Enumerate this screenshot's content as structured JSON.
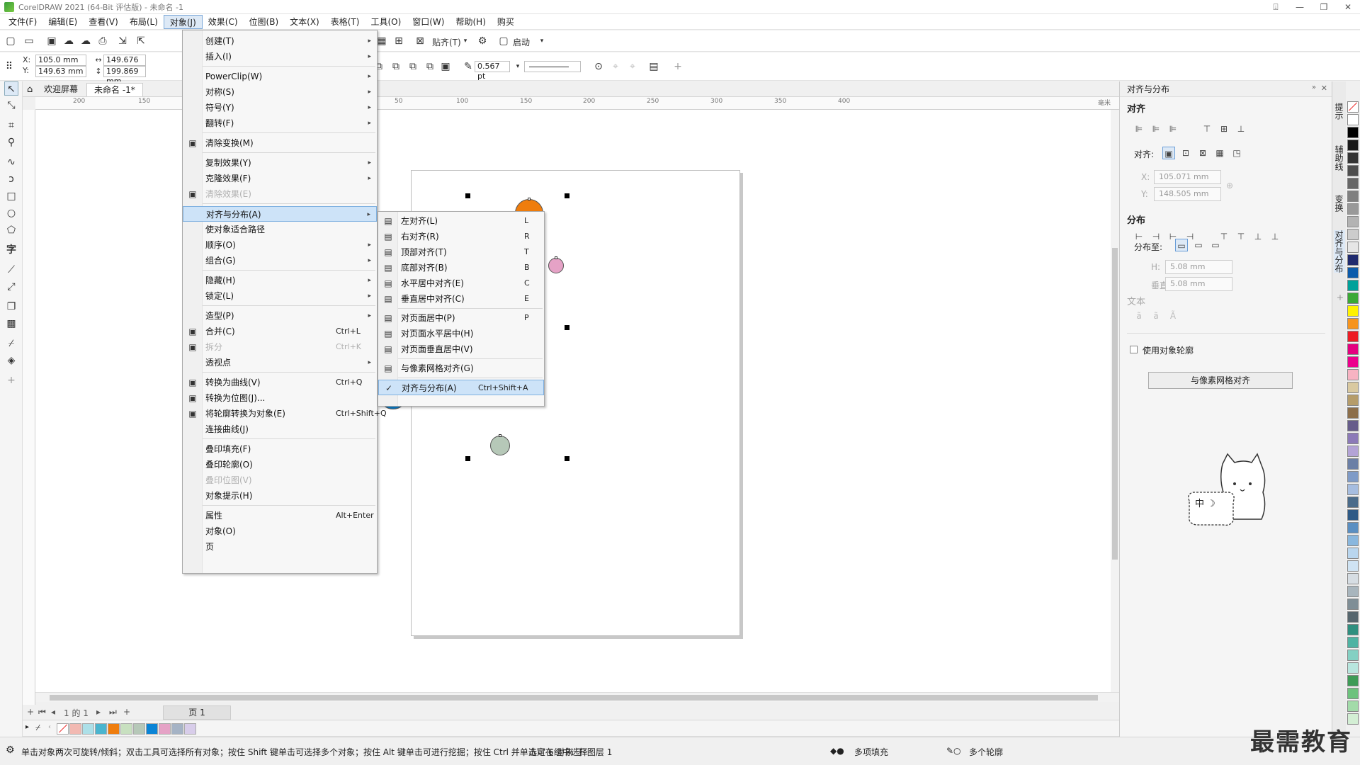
{
  "window": {
    "title": "CorelDRAW 2021 (64-Bit 评估版) - 未命名 -1",
    "controls": [
      "⍗",
      "—",
      "❐",
      "✕"
    ]
  },
  "menubar": [
    "文件(F)",
    "编辑(E)",
    "查看(V)",
    "布局(L)",
    "对象(J)",
    "效果(C)",
    "位图(B)",
    "文本(X)",
    "表格(T)",
    "工具(O)",
    "窗口(W)",
    "帮助(H)",
    "购买"
  ],
  "toolbar1": {
    "snap_label": "贴齐(T)",
    "launch_label": "启动"
  },
  "toolbar2": {
    "x": "105.0 mm",
    "y": "149.63 mm",
    "x_label": "X:",
    "y_label": "Y:",
    "w": "149.676 mm",
    "h": "199.869 mm",
    "outline": "0.567 pt"
  },
  "doctabs": [
    "欢迎屏幕",
    "未命名 -1*"
  ],
  "ruler_h": [
    "200",
    "150",
    "0",
    "50",
    "100",
    "150",
    "200",
    "250",
    "300",
    "350",
    "400"
  ],
  "ruler_unit": "毫米",
  "object_menu": [
    {
      "label": "创建(T)",
      "submenu": true
    },
    {
      "label": "插入(I)",
      "submenu": true
    },
    {
      "sep": true
    },
    {
      "label": "PowerClip(W)",
      "submenu": true
    },
    {
      "label": "对称(S)",
      "submenu": true
    },
    {
      "label": "符号(Y)",
      "submenu": true
    },
    {
      "label": "翻转(F)",
      "submenu": true
    },
    {
      "sep": true
    },
    {
      "label": "清除变换(M)",
      "icon": true
    },
    {
      "sep": true
    },
    {
      "label": "复制效果(Y)",
      "submenu": true
    },
    {
      "label": "克隆效果(F)",
      "submenu": true
    },
    {
      "label": "清除效果(E)",
      "disabled": true,
      "icon": true
    },
    {
      "sep": true
    },
    {
      "label": "对齐与分布(A)",
      "submenu": true,
      "highlighted": true
    },
    {
      "label": "使对象适合路径"
    },
    {
      "label": "顺序(O)",
      "submenu": true
    },
    {
      "label": "组合(G)",
      "submenu": true
    },
    {
      "sep": true
    },
    {
      "label": "隐藏(H)",
      "submenu": true
    },
    {
      "label": "锁定(L)",
      "submenu": true
    },
    {
      "sep": true
    },
    {
      "label": "造型(P)",
      "submenu": true
    },
    {
      "label": "合并(C)",
      "shortcut": "Ctrl+L",
      "icon": true
    },
    {
      "label": "拆分",
      "shortcut": "Ctrl+K",
      "disabled": true,
      "icon": true
    },
    {
      "label": "透视点",
      "submenu": true
    },
    {
      "sep": true
    },
    {
      "label": "转换为曲线(V)",
      "shortcut": "Ctrl+Q",
      "icon": true
    },
    {
      "label": "转换为位图(J)...",
      "icon": true
    },
    {
      "label": "将轮廓转换为对象(E)",
      "shortcut": "Ctrl+Shift+Q",
      "icon": true
    },
    {
      "label": "连接曲线(J)"
    },
    {
      "sep": true
    },
    {
      "label": "叠印填充(F)"
    },
    {
      "label": "叠印轮廓(O)"
    },
    {
      "label": "叠印位图(V)",
      "disabled": true
    },
    {
      "label": "对象提示(H)"
    },
    {
      "sep": true
    },
    {
      "label": "属性",
      "shortcut": "Alt+Enter"
    },
    {
      "label": "对象(O)"
    },
    {
      "label": "页"
    }
  ],
  "align_submenu": [
    {
      "label": "左对齐(L)",
      "shortcut": "L"
    },
    {
      "label": "右对齐(R)",
      "shortcut": "R"
    },
    {
      "label": "顶部对齐(T)",
      "shortcut": "T"
    },
    {
      "label": "底部对齐(B)",
      "shortcut": "B"
    },
    {
      "label": "水平居中对齐(E)",
      "shortcut": "C"
    },
    {
      "label": "垂直居中对齐(C)",
      "shortcut": "E"
    },
    {
      "sep": true
    },
    {
      "label": "对页面居中(P)",
      "shortcut": "P"
    },
    {
      "label": "对页面水平居中(H)",
      "shortcut": ""
    },
    {
      "label": "对页面垂直居中(V)",
      "shortcut": ""
    },
    {
      "sep": true
    },
    {
      "label": "与像素网格对齐(G)",
      "shortcut": ""
    },
    {
      "sep": true
    },
    {
      "label": "对齐与分布(A)",
      "shortcut": "Ctrl+Shift+A",
      "checked": true,
      "highlighted": true
    }
  ],
  "canvas": {
    "circles": [
      {
        "color": "#ef7d0d",
        "name": "orange-circle"
      },
      {
        "color": "#e5a2c6",
        "name": "pink-circle"
      },
      {
        "color": "#c8e0c0",
        "name": "light-green-circle"
      },
      {
        "color": "#0a84d6",
        "name": "blue-circle"
      },
      {
        "color": "#b6c8b8",
        "name": "gray-green-circle"
      }
    ]
  },
  "pagenav": {
    "pages": "1 的 1",
    "tab": "页 1"
  },
  "doc_palette": [
    "#f2b9b2",
    "#ade0e8",
    "#4ab5cf",
    "#ef7d0d",
    "#c8e0c0",
    "#b6c8b8",
    "#0a84d6",
    "#e5a2c6",
    "#a5b3c5",
    "#d8cdea"
  ],
  "status": {
    "hint": "单击对象两次可旋转/倾斜；双击工具可选择所有对象；按住 Shift 键单击可选择多个对象；按住 Alt 键单击可进行挖掘；按住 Ctrl 并单击可在组中选择",
    "selection": "选定 6 对象 于 图层 1",
    "fill": "多项填充",
    "outline": "多个轮廓"
  },
  "docker": {
    "title": "对齐与分布",
    "align_section": "对齐",
    "align_to_label": "对齐:",
    "x_label": "X:",
    "y_label": "Y:",
    "x_value": "105.071 mm",
    "y_value": "148.505 mm",
    "distribute_section": "分布",
    "distribute_to_label": "分布至:",
    "h_label": "H:",
    "v_label": "垂直:",
    "h_value": "5.08 mm",
    "v_value": "5.08 mm",
    "text_section": "文本",
    "use_outline_label": "使用对象轮廓",
    "pixel_grid_button": "与像素网格对齐",
    "mascot_text": "中 ☽"
  },
  "sidetabs": [
    "提示",
    "辅助线",
    "变换",
    "对齐与分布"
  ],
  "color_palette": [
    "#ffffff",
    "#000000",
    "#1a1a1a",
    "#333333",
    "#4d4d4d",
    "#666666",
    "#808080",
    "#999999",
    "#b3b3b3",
    "#cccccc",
    "#e6e6e6",
    "#1f2a6e",
    "#0b5bab",
    "#00a19a",
    "#3aa935",
    "#fff200",
    "#f7941d",
    "#ed1c24",
    "#e4007f",
    "#ec008c",
    "#f7b3c2",
    "#d9c9a0",
    "#b59c6a",
    "#8c6e4a",
    "#665c8a",
    "#8c7ab8",
    "#b3a3d6",
    "#6b7fa6",
    "#7f9bc7",
    "#a6bde0",
    "#4a6b8a",
    "#2e5a86",
    "#5a8fc2",
    "#89b7de",
    "#b9d6ef",
    "#cfe3f3",
    "#d6dde3",
    "#a8b5bd",
    "#7f8e96",
    "#56666e",
    "#2f8f7f",
    "#4fb3a3",
    "#84d0c3",
    "#b8e6de",
    "#3d9b56",
    "#6cc27c",
    "#a2dba9",
    "#d3eed4"
  ],
  "watermark": "最需教育"
}
